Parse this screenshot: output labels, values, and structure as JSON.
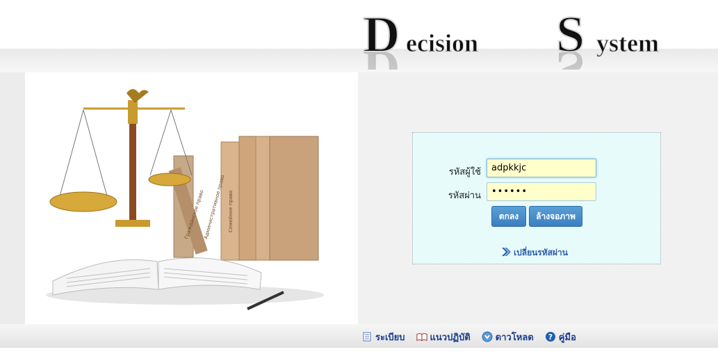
{
  "header": {
    "logo_word_1": "ecision",
    "logo_word_1_initial": "D",
    "logo_word_2": "ystem",
    "logo_word_2_initial": "S"
  },
  "login": {
    "username_label": "รหัสผู้ใช้",
    "username_value": "adpkkjc",
    "password_label": "รหัสผ่าน",
    "password_value": "••••••",
    "ok_label": "ตกลง",
    "clear_label": "ล้างจอภาพ",
    "change_password_label": "เปลี่ยนรหัสผ่าน"
  },
  "hero": {
    "book_spine_1": "Семейное право",
    "book_spine_2": "Административное право",
    "book_spine_3": "Гражданское право"
  },
  "footer": {
    "items": [
      {
        "label": "ระเบียบ",
        "icon": "document-icon"
      },
      {
        "label": "แนวปฏิบัติ",
        "icon": "book-icon"
      },
      {
        "label": "ดาวโหลด",
        "icon": "download-icon"
      },
      {
        "label": "คู่มือ",
        "icon": "help-icon"
      }
    ]
  },
  "colors": {
    "panel_bg": "#e7fbfb",
    "field_bg": "#ffffcc",
    "button_bg": "#3a7fc0",
    "link_color": "#2c5fa8",
    "nav_color": "#1c3e8a"
  }
}
